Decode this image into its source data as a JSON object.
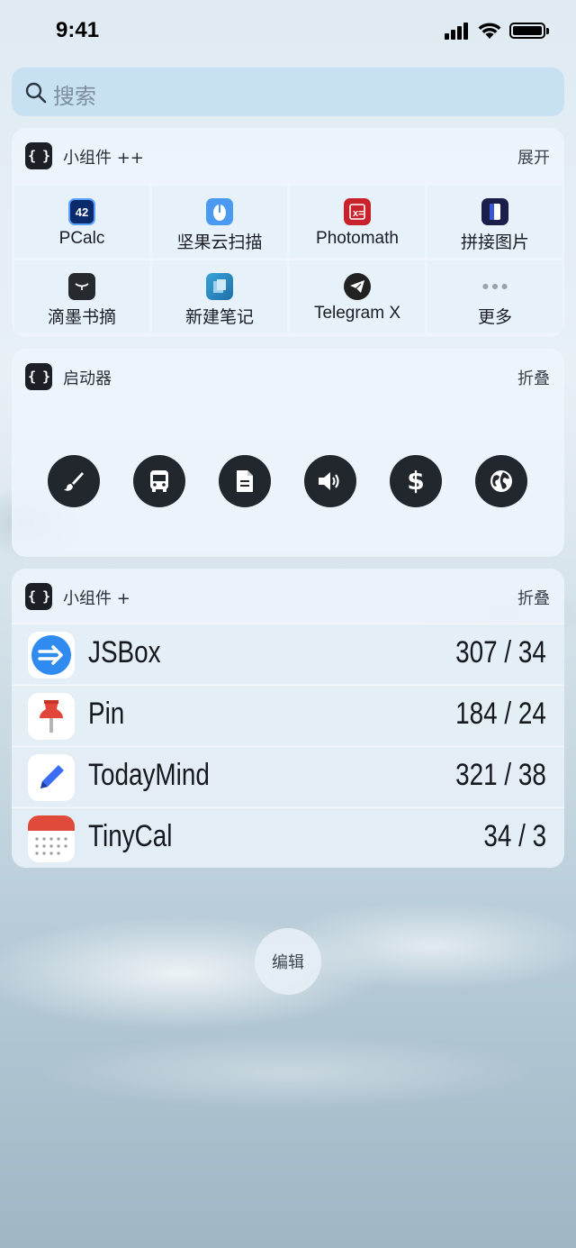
{
  "status_bar": {
    "time": "9:41"
  },
  "search": {
    "placeholder": "搜索",
    "icon": "search-icon"
  },
  "widget_grid": {
    "title": "小组件 ++",
    "action": "展开",
    "items": [
      {
        "label": "PCalc",
        "icon": "pcalc-icon",
        "icon_text": "42",
        "color": "#0b2a6b"
      },
      {
        "label": "坚果云扫描",
        "icon": "scanner-icon",
        "color": "#4a9bf0"
      },
      {
        "label": "Photomath",
        "icon": "photomath-icon",
        "color": "#c8232c"
      },
      {
        "label": "拼接图片",
        "icon": "stitch-icon",
        "color": "#1b1d4a"
      },
      {
        "label": "滴墨书摘",
        "icon": "dimo-icon",
        "color": "#26292e"
      },
      {
        "label": "新建笔记",
        "icon": "notes-icon",
        "color": "#2e8fc9"
      },
      {
        "label": "Telegram X",
        "icon": "telegram-icon",
        "color": "#222"
      },
      {
        "label": "更多",
        "icon": "more-icon",
        "color": "#9aa3ab"
      }
    ]
  },
  "launcher": {
    "title": "启动器",
    "action": "折叠",
    "buttons": [
      {
        "icon": "brush-icon"
      },
      {
        "icon": "bus-icon"
      },
      {
        "icon": "document-icon"
      },
      {
        "icon": "speaker-icon"
      },
      {
        "icon": "dollar-icon"
      },
      {
        "icon": "globe-icon"
      }
    ]
  },
  "widget_list": {
    "title": "小组件 +",
    "action": "折叠",
    "rows": [
      {
        "name": "JSBox",
        "value": "307 / 34",
        "icon": "jsbox-icon"
      },
      {
        "name": "Pin",
        "value": "184 / 24",
        "icon": "pin-icon"
      },
      {
        "name": "TodayMind",
        "value": "321 / 38",
        "icon": "todaymind-icon"
      },
      {
        "name": "TinyCal",
        "value": "34 / 3",
        "icon": "tinycal-icon"
      }
    ]
  },
  "edit_button": {
    "label": "编辑"
  }
}
